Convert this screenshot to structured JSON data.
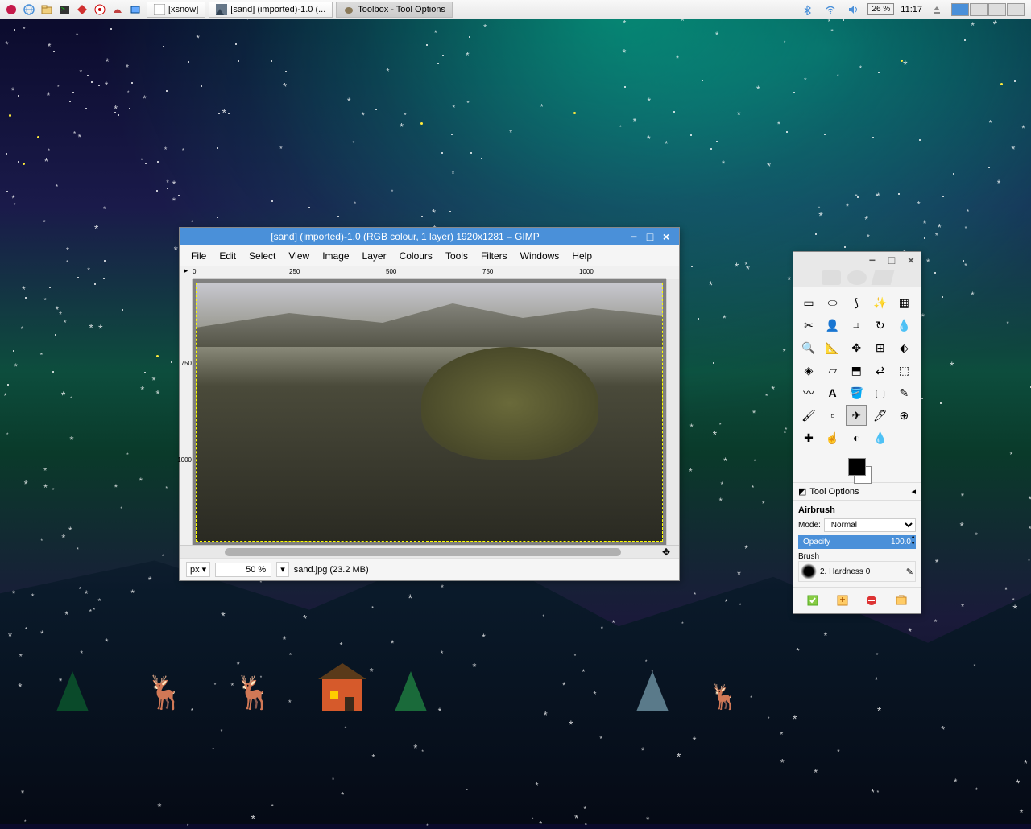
{
  "taskbar": {
    "apps": [
      {
        "name": "[xsnow]"
      },
      {
        "name": "[sand] (imported)-1.0 (..."
      },
      {
        "name": "Toolbox - Tool Options"
      }
    ],
    "battery": "26 %",
    "clock": "11:17"
  },
  "gimp": {
    "title": "[sand] (imported)-1.0 (RGB colour, 1 layer) 1920x1281 – GIMP",
    "menus": [
      "File",
      "Edit",
      "Select",
      "View",
      "Image",
      "Layer",
      "Colours",
      "Tools",
      "Filters",
      "Windows",
      "Help"
    ],
    "ruler_ticks": [
      "0",
      "250",
      "500",
      "750",
      "1000"
    ],
    "ruler_v": [
      "750",
      "1000"
    ],
    "status": {
      "unit": "px",
      "zoom": "50 %",
      "filename": "sand.jpg (23.2 MB)"
    }
  },
  "toolbox": {
    "options_title": "Tool Options",
    "tool_name": "Airbrush",
    "mode_label": "Mode:",
    "mode_value": "Normal",
    "opacity_label": "Opacity",
    "opacity_value": "100.0",
    "brush_label": "Brush",
    "brush_value": "2. Hardness 0",
    "tools": [
      "rect-select",
      "ellipse-select",
      "free-select",
      "fuzzy-select",
      "color-select",
      "scissors",
      "foreground",
      "crop",
      "rotate",
      "color-picker",
      "zoom",
      "measure",
      "move",
      "align",
      "handle",
      "unified",
      "shear",
      "perspective",
      "flip",
      "cage",
      "warp",
      "text",
      "bucket",
      "gradient",
      "pencil",
      "paintbrush",
      "eraser",
      "airbrush",
      "ink",
      "clone",
      "heal",
      "smudge",
      "dodge",
      "blur"
    ]
  }
}
